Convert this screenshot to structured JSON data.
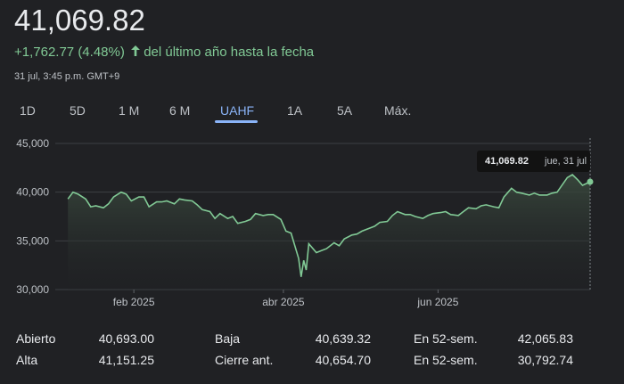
{
  "header": {
    "price": "41,069.82",
    "change": "+1,762.77 (4.48%)",
    "change_suffix": "del último año hasta la fecha",
    "timestamp": "31 jul, 3:45 p.m. GMT+9"
  },
  "tabs": [
    {
      "label": "1D"
    },
    {
      "label": "5D"
    },
    {
      "label": "1 M"
    },
    {
      "label": "6 M"
    },
    {
      "label": "UAHF",
      "active": true
    },
    {
      "label": "1A"
    },
    {
      "label": "5A"
    },
    {
      "label": "Máx."
    }
  ],
  "tooltip": {
    "value": "41,069.82",
    "date": "jue, 31 jul"
  },
  "colors": {
    "line": "#81c995",
    "accent": "#8ab4f8",
    "background": "#202124"
  },
  "chart_data": {
    "type": "area",
    "ylim": [
      30000,
      45000
    ],
    "yticks": [
      "45,000",
      "40,000",
      "35,000",
      "30,000"
    ],
    "xticks": [
      "feb 2025",
      "abr 2025",
      "jun 2025"
    ],
    "x_range": [
      "2025-01-01",
      "2025-07-31"
    ],
    "series": [
      {
        "points": [
          [
            "2025-01-06",
            39300
          ],
          [
            "2025-01-08",
            40000
          ],
          [
            "2025-01-10",
            39800
          ],
          [
            "2025-01-13",
            39300
          ],
          [
            "2025-01-15",
            38500
          ],
          [
            "2025-01-17",
            38600
          ],
          [
            "2025-01-20",
            38400
          ],
          [
            "2025-01-22",
            38800
          ],
          [
            "2025-01-24",
            39500
          ],
          [
            "2025-01-27",
            40000
          ],
          [
            "2025-01-29",
            39800
          ],
          [
            "2025-01-31",
            39100
          ],
          [
            "2025-02-03",
            39500
          ],
          [
            "2025-02-05",
            39500
          ],
          [
            "2025-02-07",
            38500
          ],
          [
            "2025-02-10",
            39000
          ],
          [
            "2025-02-12",
            39000
          ],
          [
            "2025-02-14",
            39100
          ],
          [
            "2025-02-17",
            38800
          ],
          [
            "2025-02-19",
            39300
          ],
          [
            "2025-02-21",
            39200
          ],
          [
            "2025-02-24",
            39100
          ],
          [
            "2025-02-26",
            38700
          ],
          [
            "2025-02-28",
            38200
          ],
          [
            "2025-03-03",
            38000
          ],
          [
            "2025-03-05",
            37300
          ],
          [
            "2025-03-07",
            37800
          ],
          [
            "2025-03-10",
            37300
          ],
          [
            "2025-03-12",
            37500
          ],
          [
            "2025-03-14",
            36800
          ],
          [
            "2025-03-17",
            37000
          ],
          [
            "2025-03-19",
            37200
          ],
          [
            "2025-03-21",
            37800
          ],
          [
            "2025-03-24",
            37600
          ],
          [
            "2025-03-26",
            37700
          ],
          [
            "2025-03-28",
            37700
          ],
          [
            "2025-03-31",
            37200
          ],
          [
            "2025-04-02",
            36000
          ],
          [
            "2025-04-04",
            35800
          ],
          [
            "2025-04-07",
            33200
          ],
          [
            "2025-04-08",
            31300
          ],
          [
            "2025-04-09",
            33000
          ],
          [
            "2025-04-10",
            32000
          ],
          [
            "2025-04-11",
            34700
          ],
          [
            "2025-04-14",
            33800
          ],
          [
            "2025-04-16",
            34000
          ],
          [
            "2025-04-18",
            34200
          ],
          [
            "2025-04-21",
            34800
          ],
          [
            "2025-04-23",
            34500
          ],
          [
            "2025-04-25",
            35200
          ],
          [
            "2025-04-28",
            35600
          ],
          [
            "2025-04-30",
            35700
          ],
          [
            "2025-05-02",
            36000
          ],
          [
            "2025-05-07",
            36500
          ],
          [
            "2025-05-09",
            36900
          ],
          [
            "2025-05-12",
            37000
          ],
          [
            "2025-05-14",
            37600
          ],
          [
            "2025-05-16",
            38000
          ],
          [
            "2025-05-19",
            37700
          ],
          [
            "2025-05-21",
            37700
          ],
          [
            "2025-05-23",
            37500
          ],
          [
            "2025-05-26",
            37300
          ],
          [
            "2025-05-28",
            37600
          ],
          [
            "2025-05-30",
            37800
          ],
          [
            "2025-06-02",
            37900
          ],
          [
            "2025-06-04",
            38000
          ],
          [
            "2025-06-06",
            37700
          ],
          [
            "2025-06-09",
            37600
          ],
          [
            "2025-06-11",
            38000
          ],
          [
            "2025-06-13",
            38400
          ],
          [
            "2025-06-16",
            38300
          ],
          [
            "2025-06-18",
            38600
          ],
          [
            "2025-06-20",
            38700
          ],
          [
            "2025-06-23",
            38500
          ],
          [
            "2025-06-25",
            38400
          ],
          [
            "2025-06-27",
            39500
          ],
          [
            "2025-06-30",
            40400
          ],
          [
            "2025-07-02",
            40000
          ],
          [
            "2025-07-04",
            39900
          ],
          [
            "2025-07-07",
            39700
          ],
          [
            "2025-07-09",
            39900
          ],
          [
            "2025-07-11",
            39700
          ],
          [
            "2025-07-14",
            39700
          ],
          [
            "2025-07-16",
            39900
          ],
          [
            "2025-07-18",
            40000
          ],
          [
            "2025-07-22",
            41500
          ],
          [
            "2025-07-24",
            41800
          ],
          [
            "2025-07-26",
            41300
          ],
          [
            "2025-07-28",
            40700
          ],
          [
            "2025-07-31",
            41069.82
          ]
        ]
      }
    ]
  },
  "stats": {
    "col1": [
      {
        "label": "Abierto",
        "value": "40,693.00"
      },
      {
        "label": "Alta",
        "value": "41,151.25"
      }
    ],
    "col2": [
      {
        "label": "Baja",
        "value": "40,639.32"
      },
      {
        "label": "Cierre ant.",
        "value": "40,654.70"
      }
    ],
    "col3": [
      {
        "label": "En 52-sem.",
        "value": "42,065.83"
      },
      {
        "label": "En 52-sem.",
        "value": "30,792.74"
      }
    ]
  }
}
